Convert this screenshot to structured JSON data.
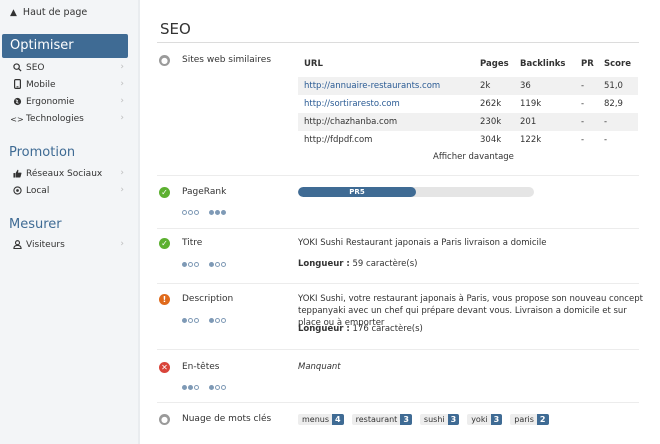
{
  "sidebar": {
    "top_link": "Haut de page",
    "active_section": "Optimiser",
    "optimiser_items": [
      {
        "label": "SEO",
        "icon": "search-icon"
      },
      {
        "label": "Mobile",
        "icon": "mobile-icon"
      },
      {
        "label": "Ergonomie",
        "icon": "globe-icon"
      },
      {
        "label": "Technologies",
        "icon": "code-icon"
      }
    ],
    "promotion_title": "Promotion",
    "promotion_items": [
      {
        "label": "Réseaux Sociaux",
        "icon": "thumbs-up-icon"
      },
      {
        "label": "Local",
        "icon": "location-icon"
      }
    ],
    "mesurer_title": "Mesurer",
    "mesurer_items": [
      {
        "label": "Visiteurs",
        "icon": "user-icon"
      }
    ]
  },
  "main": {
    "title": "SEO",
    "similar_sites": {
      "label": "Sites web similaires",
      "columns": [
        "URL",
        "Pages",
        "Backlinks",
        "PR",
        "Score"
      ],
      "rows": [
        {
          "url": "http://annuaire-restaurants.com",
          "pages": "2k",
          "backlinks": "36",
          "pr": "-",
          "score": "51,0",
          "link": true
        },
        {
          "url": "http://sortiraresto.com",
          "pages": "262k",
          "backlinks": "119k",
          "pr": "-",
          "score": "82,9",
          "link": true
        },
        {
          "url": "http://chazhanba.com",
          "pages": "230k",
          "backlinks": "201",
          "pr": "-",
          "score": "-",
          "link": false
        },
        {
          "url": "http://fdpdf.com",
          "pages": "304k",
          "backlinks": "122k",
          "pr": "-",
          "score": "-",
          "link": false
        }
      ],
      "more": "Afficher davantage"
    },
    "pagerank": {
      "label": "PageRank",
      "bar_label": "PR5",
      "value": 5,
      "max": 10
    },
    "titre": {
      "label": "Titre",
      "text": "YOKI Sushi Restaurant japonais a Paris livraison a domicile",
      "length_label": "Longueur :",
      "length_value": "59 caractère(s)"
    },
    "description": {
      "label": "Description",
      "text": "YOKI Sushi, votre restaurant japonais à Paris, vous propose son nouveau concept teppanyaki avec un chef qui prépare devant vous. Livraison a domicile et sur place ou à emporter",
      "length_label": "Longueur :",
      "length_value": "176 caractère(s)"
    },
    "headers": {
      "label": "En-têtes",
      "value": "Manquant"
    },
    "keywords": {
      "label": "Nuage de mots clés",
      "tags": [
        {
          "word": "menus",
          "count": "4"
        },
        {
          "word": "restaurant",
          "count": "3"
        },
        {
          "word": "sushi",
          "count": "3"
        },
        {
          "word": "yoki",
          "count": "3"
        },
        {
          "word": "paris",
          "count": "2"
        }
      ]
    }
  },
  "colors": {
    "accent": "#3f6b94",
    "ok": "#5cb030",
    "warn": "#e06a1b",
    "error": "#d9443a",
    "link": "#2a5b94"
  }
}
